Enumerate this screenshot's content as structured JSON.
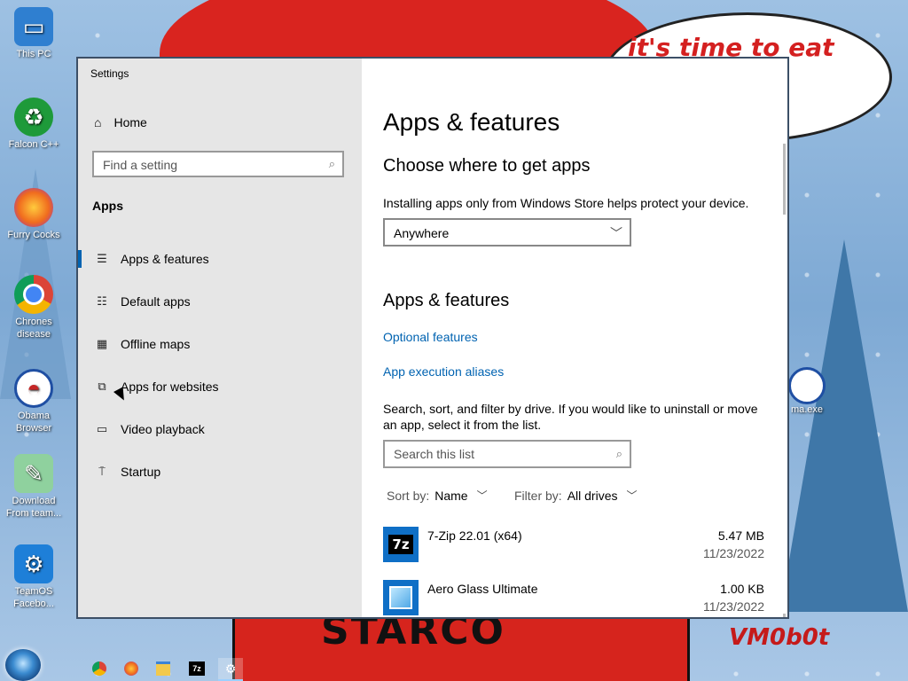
{
  "desktop": {
    "bubble_text": "it's time to eat shit chew",
    "bubble_tail": "s",
    "starco": "STARCO",
    "watermark": "VM0b0t",
    "icons": [
      {
        "label": "This PC"
      },
      {
        "label": "Falcon C++"
      },
      {
        "label": "Furry Cocks"
      },
      {
        "label": "Chrones disease"
      },
      {
        "label": "Obama Browser"
      },
      {
        "label": "Download From team..."
      },
      {
        "label": "TeamOS Facebo..."
      }
    ],
    "right_icon": "ma.exe"
  },
  "window": {
    "title": "Settings",
    "minimize_label": "",
    "maximize_label": "",
    "close_label": "✕"
  },
  "sidebar": {
    "home": "Home",
    "search_placeholder": "Find a setting",
    "section": "Apps",
    "items": [
      {
        "label": "Apps & features",
        "icon": "apps-features-icon",
        "active": true
      },
      {
        "label": "Default apps",
        "icon": "default-apps-icon",
        "active": false
      },
      {
        "label": "Offline maps",
        "icon": "offline-maps-icon",
        "active": false
      },
      {
        "label": "Apps for websites",
        "icon": "apps-websites-icon",
        "active": false
      },
      {
        "label": "Video playback",
        "icon": "video-playback-icon",
        "active": false
      },
      {
        "label": "Startup",
        "icon": "startup-icon",
        "active": false
      }
    ]
  },
  "main": {
    "page_title": "Apps & features",
    "choose_heading": "Choose where to get apps",
    "choose_desc": "Installing apps only from Windows Store helps protect your device.",
    "source_value": "Anywhere",
    "features_heading": "Apps & features",
    "optional_features": "Optional features",
    "execution_aliases": "App execution aliases",
    "search_desc": "Search, sort, and filter by drive. If you would like to uninstall or move an app, select it from the list.",
    "list_search_placeholder": "Search this list",
    "sort_label": "Sort by:",
    "sort_value": "Name",
    "filter_label": "Filter by:",
    "filter_value": "All drives",
    "apps": [
      {
        "name": "7-Zip 22.01 (x64)",
        "size": "5.47 MB",
        "date": "11/23/2022",
        "icon": "7zip-icon"
      },
      {
        "name": "Aero Glass Ultimate",
        "size": "1.00 KB",
        "date": "11/23/2022",
        "icon": "aero-glass-icon"
      }
    ]
  },
  "colors": {
    "accent": "#0063b1",
    "sidebar_bg": "#e6e6e6",
    "close_red": "#c4301f"
  }
}
